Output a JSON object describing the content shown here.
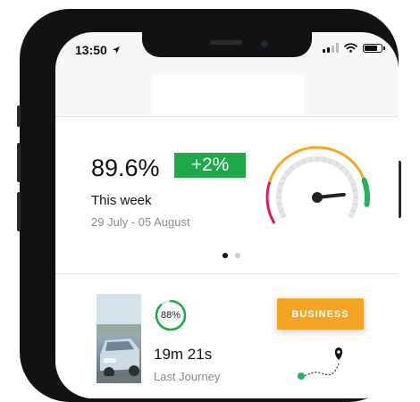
{
  "status_bar": {
    "time": "13:50"
  },
  "stats": {
    "score": "89.6%",
    "change": "+2%",
    "period_label": "This week",
    "date_range": "29 July - 05 August",
    "gauge_level": 0.85
  },
  "pagination": {
    "pages": 2,
    "active": 1
  },
  "journey": {
    "score_percent": 88,
    "score_label": "88%",
    "duration": "19m 21s",
    "label": "Last Journey",
    "category_button": "BUSINESS"
  },
  "colors": {
    "positive_green": "#1fa84a",
    "accent_orange": "#f4a424",
    "gauge_red": "#d81b60",
    "gauge_orange": "#f5a623",
    "gauge_green": "#27ae60"
  }
}
